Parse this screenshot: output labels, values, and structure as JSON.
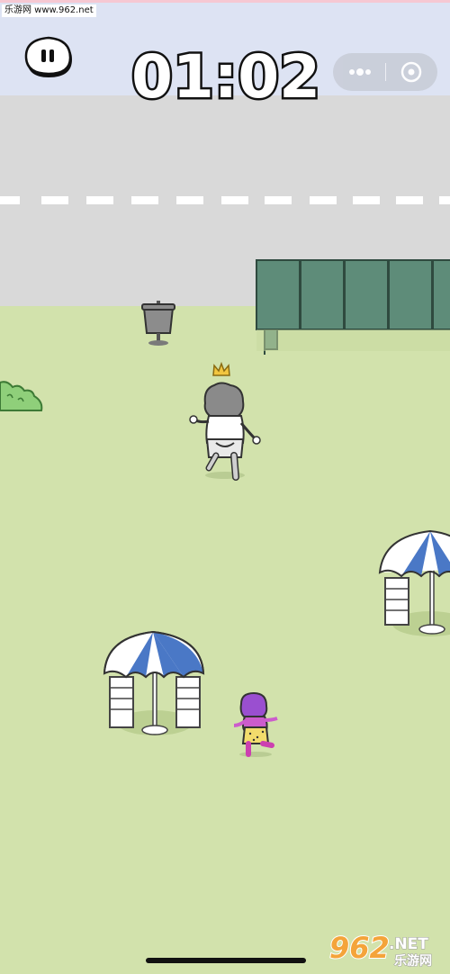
{
  "watermark": {
    "top_text": "乐游网 www.962.net",
    "bottom_brand": "962",
    "bottom_suffix": ".NET",
    "bottom_sub": "乐游网"
  },
  "hud": {
    "timer": "01:02",
    "pause_icon": "pause-icon",
    "more_icon": "more-dots-icon",
    "close_icon": "target-circle-icon"
  },
  "colors": {
    "grass": "#d2e2ac",
    "road": "#d9d9d9",
    "sky": "#dde3f3",
    "fence": "#5e8c79",
    "umbrella_blue": "#4a78c6",
    "player_purple": "#9a4fd0",
    "crown": "#f2c640"
  }
}
